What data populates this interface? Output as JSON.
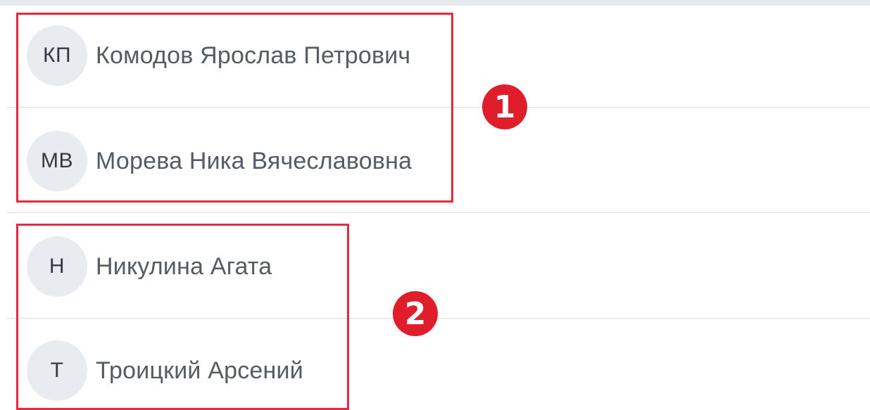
{
  "members": [
    {
      "initials": "КП",
      "name": "Комодов Ярослав Петрович"
    },
    {
      "initials": "МВ",
      "name": "Морева Ника Вячеславовна"
    },
    {
      "initials": "Н",
      "name": "Никулина Агата"
    },
    {
      "initials": "Т",
      "name": "Троицкий Арсений"
    }
  ],
  "annotations": {
    "group1_label": "1",
    "group2_label": "2",
    "highlight_color": "#e8283d",
    "badge_color": "#e01e2b"
  }
}
